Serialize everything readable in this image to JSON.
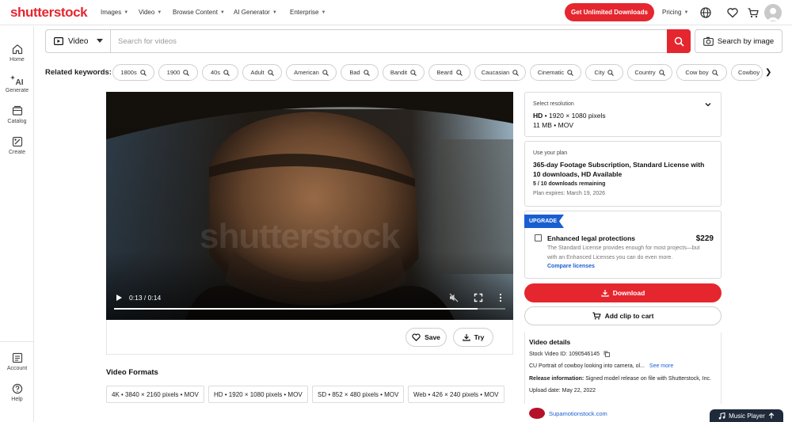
{
  "brand": {
    "logo_text": "shutterstock",
    "accent": "#e5262f",
    "link_color": "#1a5fd1"
  },
  "topnav": {
    "items": [
      "Images",
      "Video",
      "Browse Content",
      "AI Generator",
      "Enterprise"
    ],
    "unlimited_label": "Get Unlimited Downloads",
    "pricing_label": "Pricing",
    "icons": [
      "globe-icon",
      "heart-icon",
      "cart-icon",
      "avatar"
    ]
  },
  "sidebar": {
    "items": [
      {
        "label": "Home",
        "icon": "home-icon"
      },
      {
        "label": "Generate",
        "icon": "ai-sparkle-icon"
      },
      {
        "label": "Catalog",
        "icon": "catalog-icon"
      },
      {
        "label": "Create",
        "icon": "create-icon"
      },
      {
        "label": "Account",
        "icon": "account-icon"
      },
      {
        "label": "Help",
        "icon": "help-icon"
      }
    ]
  },
  "search": {
    "type_label": "Video",
    "placeholder": "Search for videos",
    "value": "",
    "by_image_label": "Search by image"
  },
  "related": {
    "label": "Related keywords:",
    "keywords": [
      "1800s",
      "1900",
      "40s",
      "Adult",
      "American",
      "Bad",
      "Bandit",
      "Beard",
      "Caucasian",
      "Cinematic",
      "City",
      "Country",
      "Cow boy",
      "Cowboy"
    ]
  },
  "player": {
    "watermark": "shutterstock",
    "time": "0:13 / 0:14",
    "progress": 0.93
  },
  "actions": {
    "save_label": "Save",
    "try_label": "Try"
  },
  "formats": {
    "title": "Video Formats",
    "items": [
      "4K • 3840 × 2160 pixels • MOV",
      "HD • 1920 × 1080 pixels • MOV",
      "SD • 852 × 480 pixels • MOV",
      "Web • 426 × 240 pixels • MOV"
    ]
  },
  "resolution": {
    "title": "Select resolution",
    "quality": "HD",
    "dims": " • 1920 × 1080 pixels",
    "size": "11 MB • MOV"
  },
  "plan": {
    "title": "Use your plan",
    "name": "365-day Footage Subscription, Standard License with 10 downloads, HD Available",
    "remaining": "5 / 10 downloads remaining",
    "expires": "Plan expires: March 19, 2026"
  },
  "upgrade": {
    "badge": "UPGRADE",
    "title": "Enhanced legal protections",
    "price": "$229",
    "description": "The Standard License provides enough for most projects—but with an Enhanced Licenses you can do even more.",
    "link": "Compare licenses",
    "checked": false
  },
  "buttons": {
    "download": "Download",
    "add_to_cart": "Add clip to cart"
  },
  "details": {
    "title": "Video details",
    "stock_id": "Stock Video ID: 1090546145",
    "description": "CU Portrait of cowboy looking into camera, ol...",
    "see_more": "See more",
    "release_label": "Release information:",
    "release_text": " Signed model release on file with Shutterstock, Inc.",
    "upload_date": "Upload date: May 22, 2022"
  },
  "contributor": {
    "name": "Supamotionstock.com"
  },
  "music_player": {
    "label": "Music Player"
  }
}
